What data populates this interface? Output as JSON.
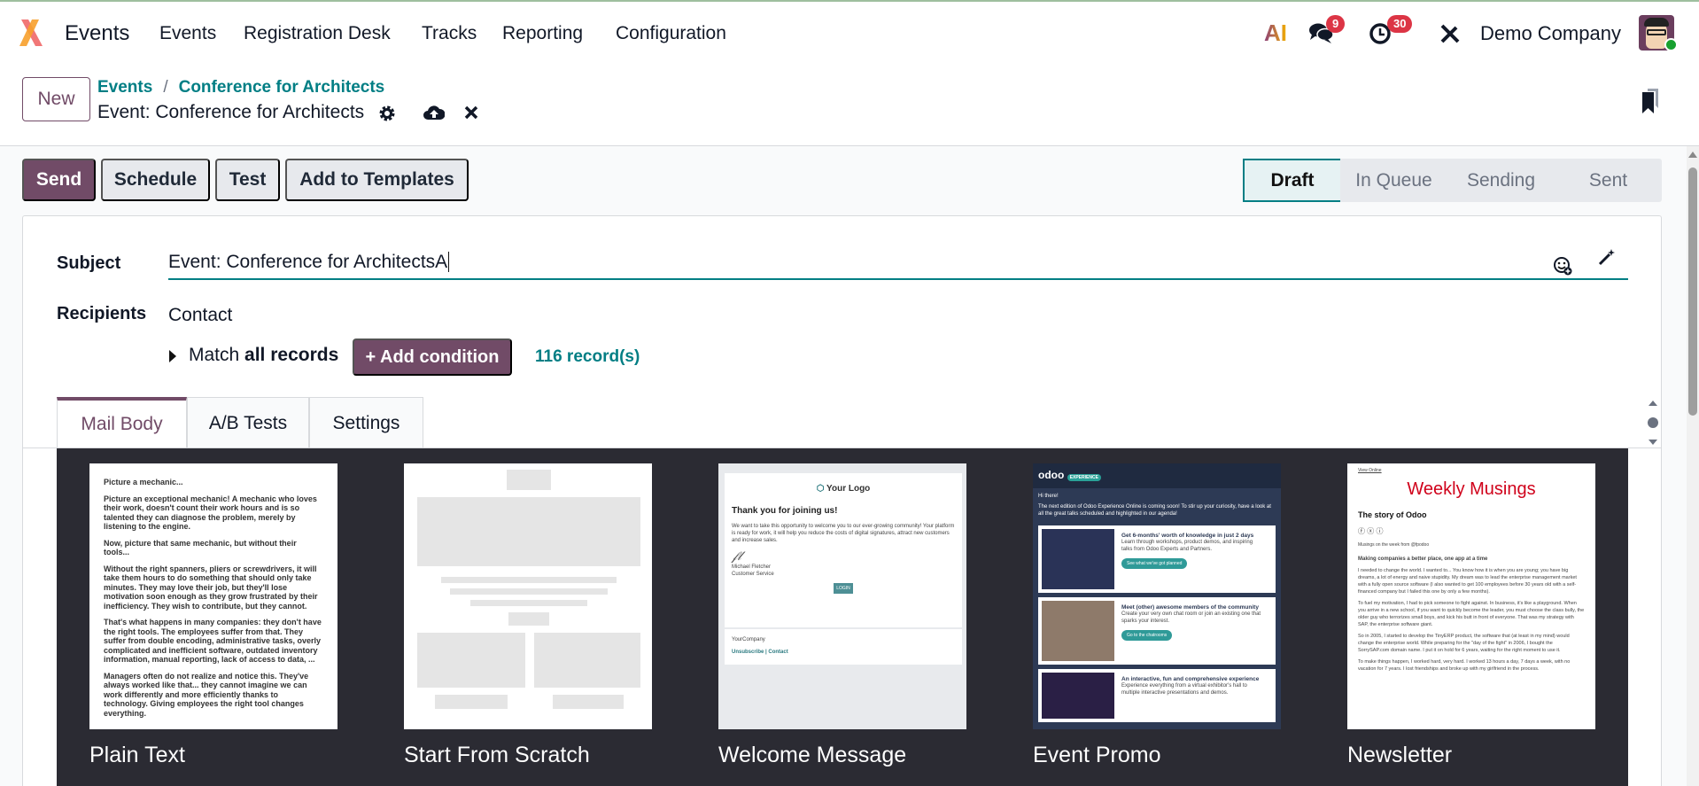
{
  "nav": {
    "brand": "Events",
    "menu": [
      "Events",
      "Registration Desk",
      "Tracks",
      "Reporting",
      "Configuration"
    ],
    "ai_label": "AI",
    "messages_count": "9",
    "activities_count": "30",
    "company": "Demo Company"
  },
  "control": {
    "new_label": "New",
    "breadcrumb": [
      "Events",
      "Conference for Architects"
    ],
    "breadcrumb_sep": "/",
    "record_title": "Event: Conference for Architects"
  },
  "actions": {
    "send": "Send",
    "schedule": "Schedule",
    "test": "Test",
    "add_to_templates": "Add to Templates"
  },
  "status": {
    "stages": [
      "Draft",
      "In Queue",
      "Sending",
      "Sent"
    ],
    "current": "Draft"
  },
  "form": {
    "subject_label": "Subject",
    "subject_value": "Event: Conference for ArchitectsA",
    "recipients_label": "Recipients",
    "recipients_value": "Contact",
    "match_prefix": "Match",
    "match_bold": "all records",
    "add_condition": "+ Add condition",
    "record_count": "116 record(s)"
  },
  "tabs": [
    {
      "label": "Mail Body",
      "active": true
    },
    {
      "label": "A/B Tests"
    },
    {
      "label": "Settings"
    }
  ],
  "templates": [
    {
      "name": "Plain Text",
      "lines": [
        "Picture a mechanic...",
        "Picture an exceptional mechanic! A mechanic who loves their work, doesn't count their work hours and is so talented they can diagnose the problem, merely by listening to the engine.",
        "Now, picture that same mechanic, but without their tools...",
        "Without the right spanners, pliers or screwdrivers, it will take them hours to do something that should only take minutes. They may love their job, but they'll lose motivation soon enough as they grow frustrated by their inefficiency. They wish to contribute, but they cannot.",
        "That's what happens in many companies: they don't have the right tools. The employees suffer from that. They suffer from double encoding, administrative tasks, overly complicated and inefficient software, outdated inventory information, manual reporting, lack of access to data, ...",
        "Managers often do not realize and notice this. They've always worked like that... they cannot imagine we can work differently and more efficiently thanks to technology. Giving employees the right tool changes everything."
      ]
    },
    {
      "name": "Start From Scratch"
    },
    {
      "name": "Welcome Message",
      "logo": "Your Logo",
      "heading": "Thank you for joining us!",
      "body": "We want to take this opportunity to welcome you to our ever-growing community! Your platform is ready for work, it will help you reduce the costs of digital signatures, attract new customers and increase sales.",
      "signer": "Michael Fletcher",
      "signer_role": "Customer Service",
      "button": "LOGIN",
      "footer_company": "YourCompany",
      "footer_links": "Unsubscribe | Contact"
    },
    {
      "name": "Event Promo",
      "brand": "odoo",
      "brand_tag": "EXPERIENCE",
      "greeting": "Hi there!",
      "intro": "The next edition of Odoo Experience Online is coming soon! To stir up your curiosity, have a look at all the great talks scheduled and highlighted in our agenda!",
      "cards": [
        {
          "title": "Get 6-months' worth of knowledge in just 2 days",
          "text": "Learn through workshops, product demos, and inspiring talks from Odoo Experts and Partners.",
          "button": "See what we've got planned"
        },
        {
          "title": "Meet (other) awesome members of the community",
          "text": "Create your very own chat room or join an existing one that sparks your interest.",
          "button": "Go to the chatrooms"
        },
        {
          "title": "An interactive, fun and comprehensive experience",
          "text": "Experience everything from a virtual exhibitor's hall to multiple interactive presentations and demos."
        }
      ]
    },
    {
      "name": "Newsletter",
      "view_online": "View Online",
      "title": "Weekly Musings",
      "story": "The story of Odoo",
      "musings": "Musings on the week from @fpodoo",
      "subheading": "Making companies a better place, one app at a time",
      "paragraphs": [
        "I needed to change the world. I wanted to... You know how it is when you are young; you have big dreams, a lot of energy and naive stupidity. My dream was to lead the enterprise management market with a fully open source software (I also wanted to get 100 employees before 30 years old with a self-financed company but I failed this one by only a few months).",
        "To fuel my motivation, I had to pick someone to fight against. In business, it's like a playground. When you arrive in a new school, if you want to quickly become the leader, you must choose the class bully, the older guy who terrorizes small boys, and kick his butt in front of everyone. That was my strategy with SAP, the enterprise software giant.",
        "So in 2005, I started to develop the TinyERP product, the software that (at least in my mind) would change the enterprise world. While preparing for the \"day of the fight\" in 2006, I bought the SorrySAP.com domain name. I put it on hold for 6 years, waiting for the right moment to use it.",
        "To make things happen, I worked hard, very hard. I worked 13 hours a day, 7 days a week, with no vacation for 7 years. I lost friendships and broke up with my girlfriend in the process."
      ]
    }
  ],
  "colors": {
    "primary": "#714b67",
    "accent": "#017e84",
    "badge": "#dc3545",
    "dark_bg": "#2b2b33"
  }
}
